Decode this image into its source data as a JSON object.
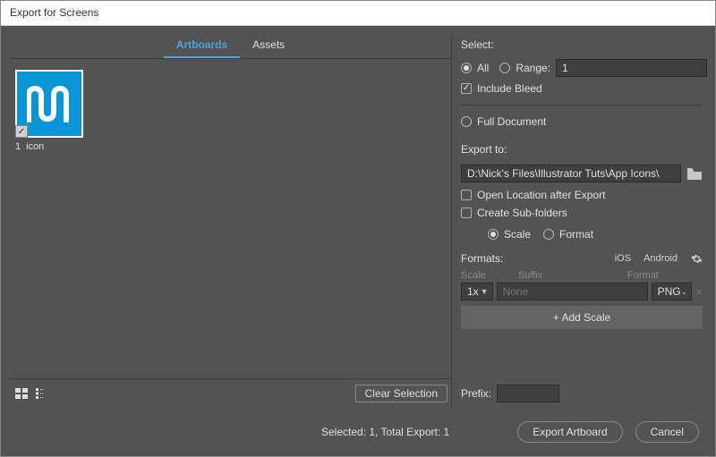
{
  "title": "Export for Screens",
  "tabs": {
    "artboards": "Artboards",
    "assets": "Assets"
  },
  "artboard": {
    "index": "1",
    "name": "icon"
  },
  "clear_selection": "Clear Selection",
  "select": {
    "label": "Select:",
    "all": "All",
    "range": "Range:",
    "range_value": "1",
    "include_bleed": "Include Bleed",
    "full_document": "Full Document"
  },
  "export": {
    "label": "Export to:",
    "path": "D:\\Nick's Files\\Illustrator Tuts\\App Icons\\",
    "open_location": "Open Location after Export",
    "create_subfolders": "Create Sub-folders",
    "scale_opt": "Scale",
    "format_opt": "Format"
  },
  "formats": {
    "label": "Formats:",
    "ios": "iOS",
    "android": "Android",
    "head_scale": "Scale",
    "head_suffix": "Suffix",
    "head_format": "Format",
    "row": {
      "scale": "1x",
      "suffix_placeholder": "None",
      "format": "PNG"
    },
    "add_scale": "+  Add Scale"
  },
  "prefix": {
    "label": "Prefix:",
    "value": ""
  },
  "status": "Selected: 1, Total Export: 1",
  "buttons": {
    "export": "Export Artboard",
    "cancel": "Cancel"
  }
}
